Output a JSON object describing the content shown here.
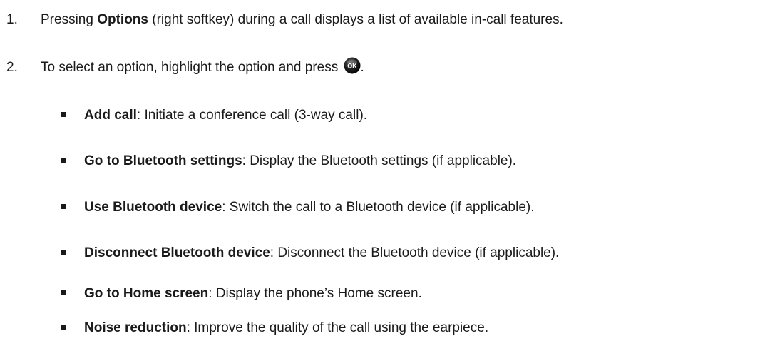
{
  "steps": [
    {
      "number": "1.",
      "prefix": "Pressing ",
      "bold": "Options",
      "suffix": " (right softkey) during a call displays a list of available in-call features."
    },
    {
      "number": "2.",
      "text": "To select an option, highlight the option and press",
      "after_icon": ".",
      "icon": "ok-button-icon",
      "icon_label": "OK"
    }
  ],
  "options": [
    {
      "term": "Add call",
      "desc": ": Initiate a conference call (3-way call)."
    },
    {
      "term": "Go to Bluetooth settings",
      "desc": ": Display the Bluetooth settings (if applicable)."
    },
    {
      "term": "Use Bluetooth device",
      "desc": ": Switch the call to a Bluetooth device (if applicable)."
    },
    {
      "term": "Disconnect Bluetooth device",
      "desc": ": Disconnect the Bluetooth device (if applicable)."
    },
    {
      "term": "Go to Home screen",
      "desc": ": Display the phone’s Home screen."
    },
    {
      "term": "Noise reduction",
      "desc": ": Improve the quality of the call using the earpiece."
    }
  ]
}
